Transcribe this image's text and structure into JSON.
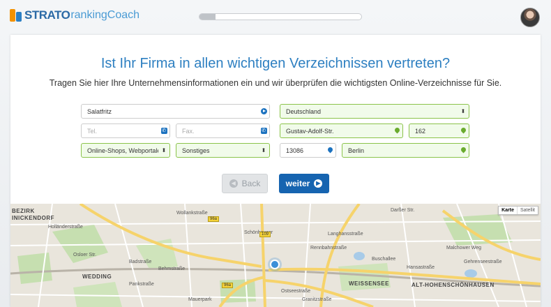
{
  "brand": {
    "strato": "STRATO",
    "rc": "rankingCoach"
  },
  "progress": {
    "fraction": 0.1
  },
  "title": "Ist Ihr Firma in allen wichtigen Verzeichnissen vertreten?",
  "subtitle": "Tragen Sie hier Ihre Unternehmensinformationen ein und wir überprüfen die wichtigsten Online-Verzeichnisse für Sie.",
  "form": {
    "company": "Salatfritz",
    "country": "Deutschland",
    "phone_placeholder": "Tel.",
    "fax_placeholder": "Fax.",
    "street": "Gustav-Adolf-Str.",
    "house_number": "162",
    "category": "Online-Shops, Webportale",
    "subcategory": "Sonstiges",
    "zip": "13086",
    "city": "Berlin"
  },
  "buttons": {
    "back": "Back",
    "next": "weiter"
  },
  "map": {
    "type_map": "Karte",
    "type_satellite": "Satellit",
    "labels": {
      "bezirk": "BEZIRK",
      "reinickendorf": "INICKENDORF",
      "wedding": "WEDDING",
      "weissensee": "WEISSENSEE",
      "hohenschoenhausen": "ALT-HOHENSCHÖNHAUSEN",
      "darsser": "Darßer Str.",
      "hollaender": "Holländerstraße",
      "osloer": "Osloer Str.",
      "behmstrasse": "Behmstraße",
      "mauerpark": "Mauerpark",
      "ostseestrasse": "Ostseestraße",
      "buschallee": "Buschallee",
      "hansastrasse": "Hansastraße",
      "gehrenseestrasse": "Gehrenseestraße",
      "rennbahnstrasse": "Rennbahnstraße",
      "badstrasse": "Badstraße",
      "pankstrasse": "Pankstraße",
      "wollankstrasse": "Wollankstraße",
      "granitzstrasse": "Granitzstraße",
      "langhansstrasse": "Langhansstraße",
      "malchower": "Malchower Weg",
      "schoenhauser": "Schönhauser",
      "r96a": "96a",
      "r109": "109"
    }
  }
}
